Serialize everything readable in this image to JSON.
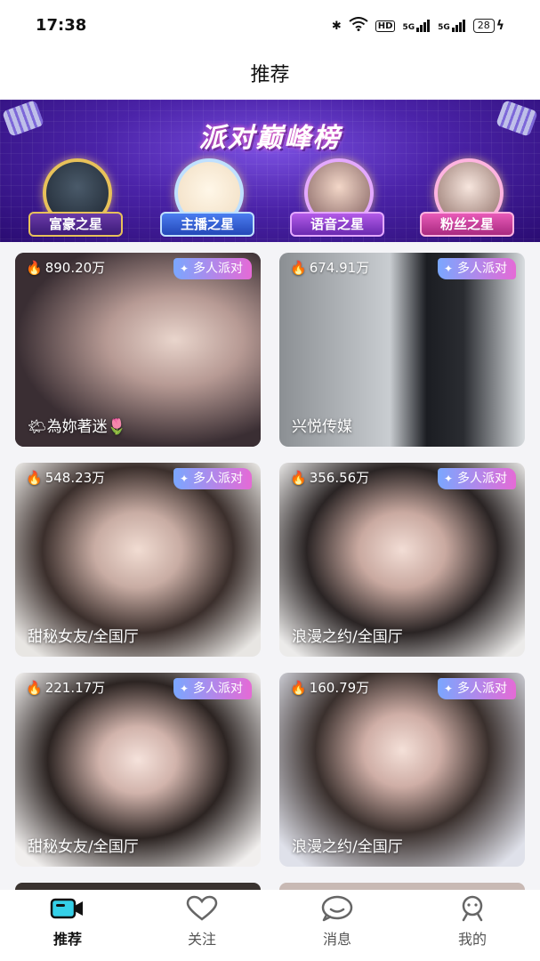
{
  "status_bar": {
    "time": "17:38",
    "network_badge": "HD",
    "signal_1": "5G",
    "signal_2": "5G",
    "battery": "28"
  },
  "header": {
    "title": "推荐"
  },
  "banner": {
    "title": "派对巅峰榜",
    "badges": [
      {
        "label": "富豪之星",
        "color": "#c6901f"
      },
      {
        "label": "主播之星",
        "color": "#3a6fe0"
      },
      {
        "label": "语音之星",
        "color": "#a24de0"
      },
      {
        "label": "粉丝之星",
        "color": "#d94aa8"
      }
    ]
  },
  "rooms": [
    {
      "heat": "890.20万",
      "tag": "多人派对",
      "name": "🌤為妳著迷🌷"
    },
    {
      "heat": "674.91万",
      "tag": "多人派对",
      "name": "兴悦传媒"
    },
    {
      "heat": "548.23万",
      "tag": "多人派对",
      "name": "甜秘女友/全国厅"
    },
    {
      "heat": "356.56万",
      "tag": "多人派对",
      "name": "浪漫之约/全国厅"
    },
    {
      "heat": "221.17万",
      "tag": "多人派对",
      "name": "甜秘女友/全国厅"
    },
    {
      "heat": "160.79万",
      "tag": "多人派对",
      "name": "浪漫之约/全国厅"
    }
  ],
  "tabs": [
    {
      "label": "推荐",
      "icon": "video-camera-icon",
      "active": true
    },
    {
      "label": "关注",
      "icon": "heart-icon",
      "active": false
    },
    {
      "label": "消息",
      "icon": "chat-bubble-icon",
      "active": false
    },
    {
      "label": "我的",
      "icon": "person-icon",
      "active": false
    }
  ],
  "colors": {
    "accent_tag_start": "#7aa7ff",
    "accent_tag_end": "#e56ad6",
    "tab_active": "#111111"
  }
}
